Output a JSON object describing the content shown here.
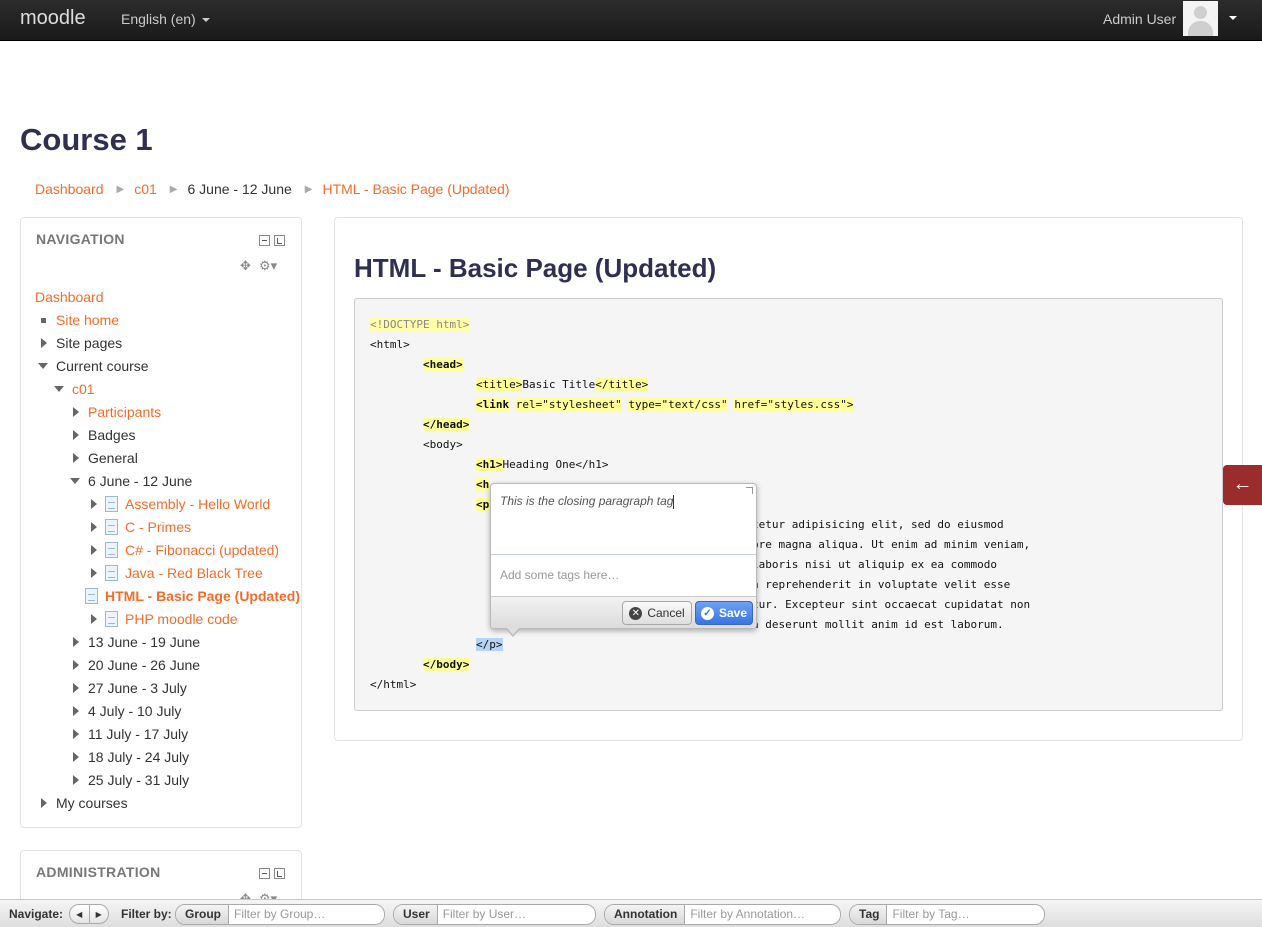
{
  "navbar": {
    "brand": "moodle",
    "language": "English (en)",
    "user": "Admin User"
  },
  "page": {
    "title": "Course 1"
  },
  "breadcrumb": [
    {
      "label": "Dashboard"
    },
    {
      "label": "c01"
    },
    {
      "label": "6 June - 12 June"
    },
    {
      "label": "HTML - Basic Page (Updated)"
    }
  ],
  "navigation": {
    "title": "NAVIGATION",
    "items": [
      {
        "label": "Dashboard"
      },
      {
        "label": "Site home"
      },
      {
        "label": "Site pages"
      },
      {
        "label": "Current course"
      },
      {
        "label": "c01"
      },
      {
        "label": "Participants"
      },
      {
        "label": "Badges"
      },
      {
        "label": "General"
      },
      {
        "label": "6 June - 12 June"
      },
      {
        "label": "Assembly - Hello World"
      },
      {
        "label": "C - Primes"
      },
      {
        "label": "C# - Fibonacci (updated)"
      },
      {
        "label": "Java - Red Black Tree"
      },
      {
        "label": "HTML - Basic Page (Updated)"
      },
      {
        "label": "PHP moodle code"
      },
      {
        "label": "13 June - 19 June"
      },
      {
        "label": "20 June - 26 June"
      },
      {
        "label": "27 June - 3 July"
      },
      {
        "label": "4 July - 10 July"
      },
      {
        "label": "11 July - 17 July"
      },
      {
        "label": "18 July - 24 July"
      },
      {
        "label": "25 July - 31 July"
      },
      {
        "label": "My courses"
      }
    ]
  },
  "administration": {
    "title": "ADMINISTRATION"
  },
  "main": {
    "title": "HTML - Basic Page (Updated)",
    "code": {
      "l1": "<!DOCTYPE html>",
      "l2": "<html>",
      "l3": "<head>",
      "l4a": "<title>",
      "l4b": "Basic Title",
      "l4c": "</title>",
      "l5a": "<link",
      "l5b": "rel=\"stylesheet\"",
      "l5c": "type=\"text/css\"",
      "l5d": "href=\"styles.css\">",
      "l6": "</head>",
      "l7": "<body>",
      "l8a": "<h1>",
      "l8b": "Heading One</h1>",
      "l9": "<h",
      "l10": "<p",
      "l11": "tetur adipisicing elit, sed do eiusmod",
      "l12": "ore magna aliqua. Ut enim ad minim veniam,",
      "l13": "laboris nisi ut aliquip ex ea commodo",
      "l14": "n reprehenderit in voluptate velit esse",
      "l15": "tur. Excepteur sint occaecat cupidatat non",
      "l16": "a deserunt mollit anim id est laborum.",
      "l17": "</p>",
      "l18": "</body>",
      "l19": "</html>"
    }
  },
  "annotation_editor": {
    "text": "This is the closing paragraph tag",
    "tags_placeholder": "Add some tags here…",
    "cancel_label": "Cancel",
    "save_label": "Save"
  },
  "filter_bar": {
    "navigate_label": "Navigate:",
    "filter_by_label": "Filter by:",
    "group_label": "Group",
    "group_placeholder": "Filter by Group…",
    "user_label": "User",
    "user_placeholder": "Filter by User…",
    "annotation_label": "Annotation",
    "annotation_placeholder": "Filter by Annotation…",
    "tag_label": "Tag",
    "tag_placeholder": "Filter by Tag…"
  },
  "colors": {
    "link": "#f06d2b",
    "heading": "#2f2f52",
    "navbar": "#1a1a1a",
    "highlight": "#ffff99",
    "selection": "#b6d4f5",
    "save_button": "#3875e0",
    "side_tab": "#9a2c2c"
  },
  "icons": [
    "user-avatar-icon",
    "caret-down-icon",
    "minimize-icon",
    "dock-icon",
    "move-icon",
    "gear-icon",
    "page-icon",
    "cancel-icon",
    "check-icon",
    "arrow-left-icon",
    "prev-icon",
    "next-icon"
  ]
}
